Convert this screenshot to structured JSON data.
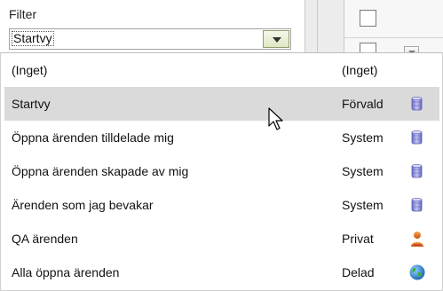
{
  "filter": {
    "label": "Filter",
    "selected_value": "Startvy"
  },
  "dropdown": {
    "options": [
      {
        "name": "(Inget)",
        "type": "(Inget)",
        "icon": "none"
      },
      {
        "name": "Startvy",
        "type": "Förvald",
        "icon": "database-icon",
        "selected": true
      },
      {
        "name": "Öppna ärenden tilldelade mig",
        "type": "System",
        "icon": "database-icon"
      },
      {
        "name": "Öppna ärenden skapade av mig",
        "type": "System",
        "icon": "database-icon"
      },
      {
        "name": "Ärenden som jag bevakar",
        "type": "System",
        "icon": "database-icon"
      },
      {
        "name": "QA ärenden",
        "type": "Privat",
        "icon": "user-icon"
      },
      {
        "name": "Alla öppna ärenden",
        "type": "Delad",
        "icon": "globe-icon"
      }
    ]
  },
  "colors": {
    "selected_row": "#dadada",
    "select_button_border": "#8f9f6a",
    "database_icon": "#8d8fd6",
    "user_icon": "#e0731f",
    "globe_icon": "#2f7fd0"
  }
}
